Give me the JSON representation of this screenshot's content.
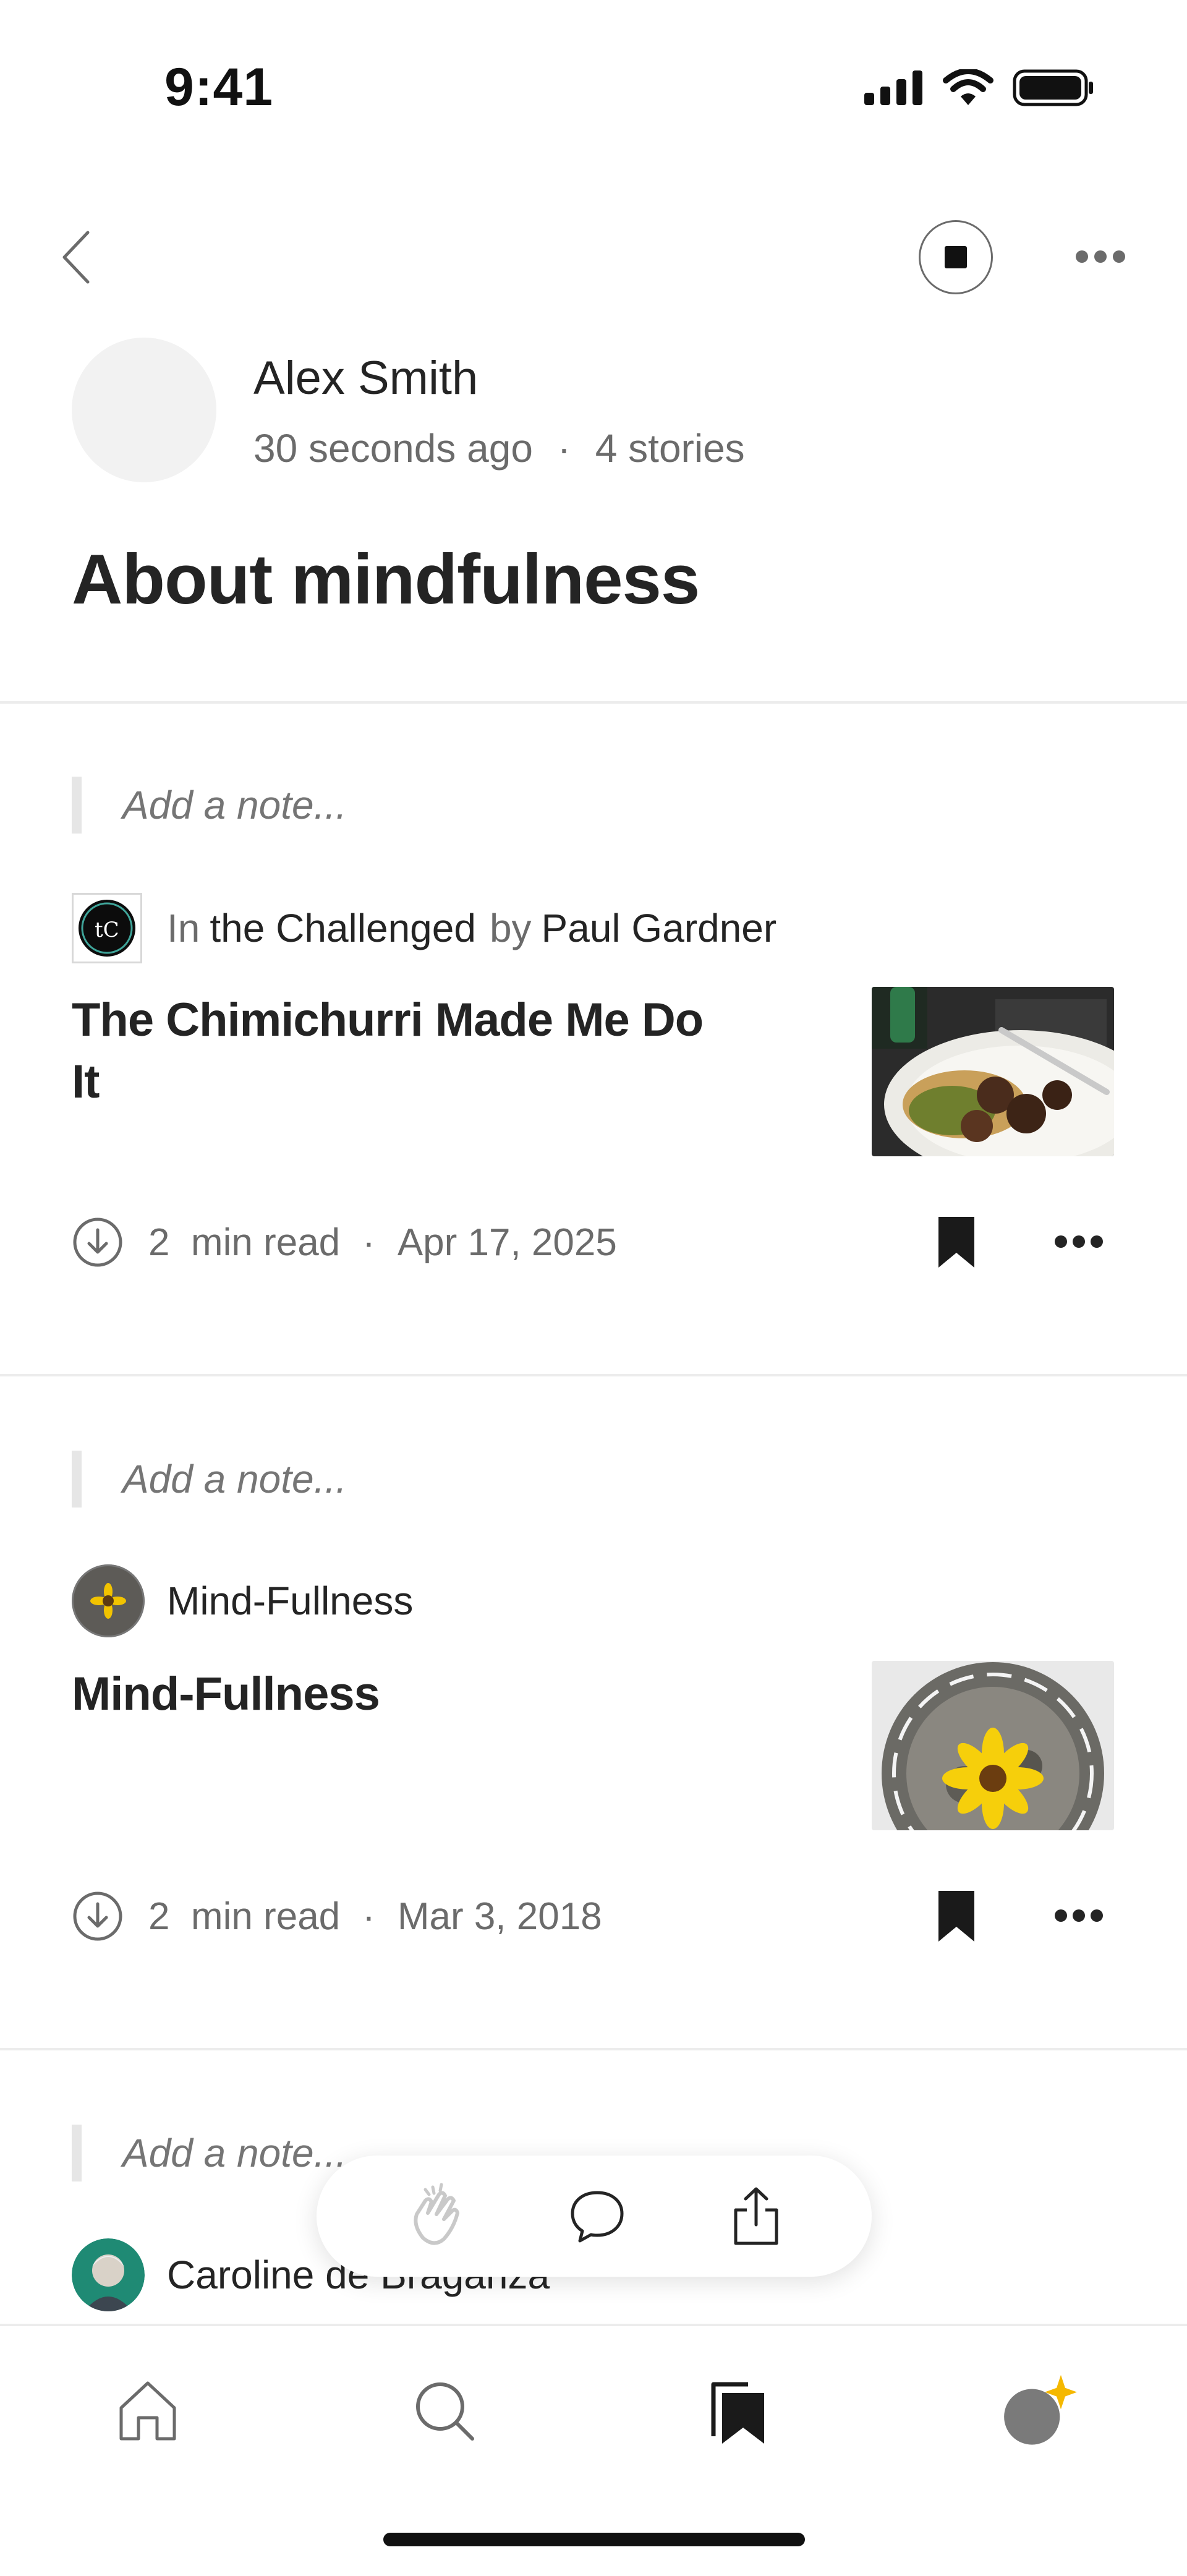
{
  "status_bar": {
    "time": "9:41"
  },
  "nav": {
    "back_icon": "chevron-left-icon",
    "stop_icon": "stop-icon",
    "more_icon": "more-horizontal-icon"
  },
  "header": {
    "author_name": "Alex Smith",
    "updated": "30 seconds ago",
    "separator": "·",
    "story_count": "4 stories",
    "title": "About mindfulness"
  },
  "items": [
    {
      "note_placeholder": "Add a note...",
      "pub_prefix": "In",
      "publication": "the Challenged",
      "by_word": "by",
      "author": "Paul Gardner",
      "title": "The Chimichurri Made Me Do It",
      "read_time": "2  min read",
      "separator": "·",
      "date": "Apr 17, 2025"
    },
    {
      "note_placeholder": "Add a note...",
      "publication": "Mind-Fullness",
      "title": "Mind-Fullness",
      "read_time": "2  min read",
      "separator": "·",
      "date": "Mar 3, 2018"
    },
    {
      "note_placeholder": "Add a note...",
      "author": "Caroline de Braganza"
    }
  ],
  "float_actions": [
    "clap-icon",
    "comment-icon",
    "share-icon"
  ],
  "tabbar": [
    "home-icon",
    "search-icon",
    "bookmarks-icon",
    "profile-icon"
  ],
  "colors": {
    "accent_star": "#f5b800",
    "text": "#242424",
    "muted": "#6b6b6b"
  }
}
